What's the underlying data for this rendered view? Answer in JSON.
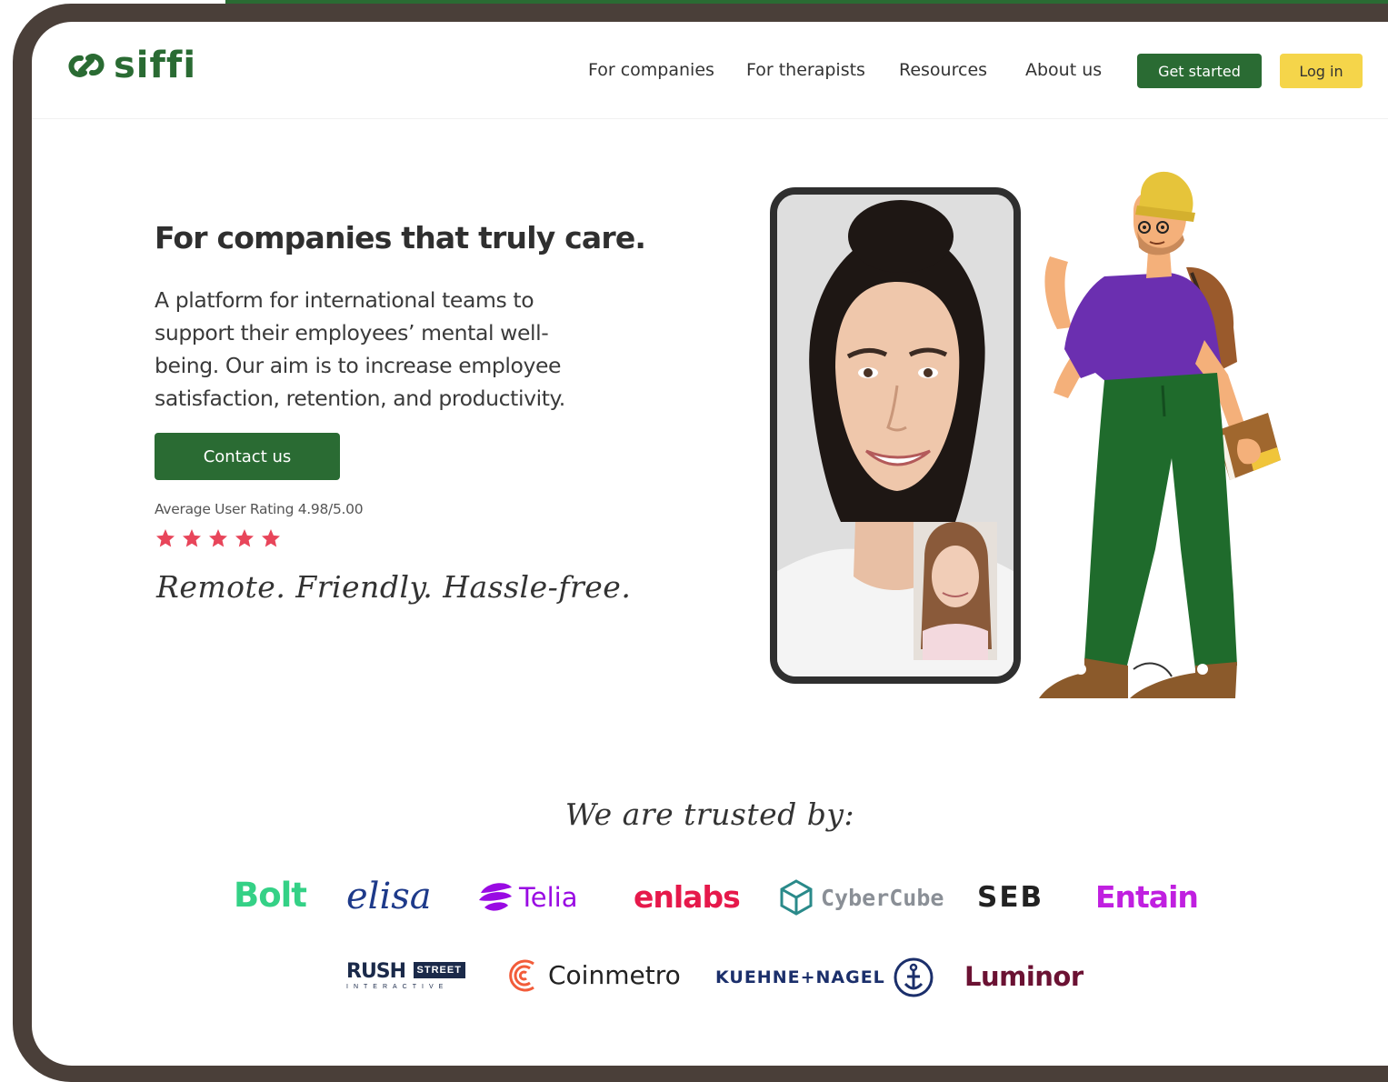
{
  "brand": {
    "name": "siffi",
    "color": "#2a6b33"
  },
  "nav": {
    "items": [
      "For companies",
      "For therapists",
      "Resources",
      "About us"
    ],
    "get_started": "Get started",
    "log_in": "Log in"
  },
  "hero": {
    "title": "For companies that truly care.",
    "description": "A platform for international teams to support their employees’ mental well-being. Our aim is to increase employee satisfaction, retention, and productivity.",
    "contact_button": "Contact us",
    "rating_text": "Average User Rating 4.98/5.00",
    "stars": 5,
    "tagline": "Remote. Friendly. Hassle-free."
  },
  "trusted": {
    "title": "We are trusted by:",
    "logos": [
      {
        "name": "Bolt",
        "color": "#34d186",
        "icon": "bolt-logo"
      },
      {
        "name": "elisa",
        "color": "#1e3a8a",
        "icon": "elisa-logo"
      },
      {
        "name": "Telia",
        "color": "#990ae3",
        "icon": "telia-logo"
      },
      {
        "name": "enlabs",
        "color": "#e6194b",
        "icon": "enlabs-logo"
      },
      {
        "name": "CyberCube",
        "color": "#8a8f96",
        "icon": "cybercube-logo"
      },
      {
        "name": "SEB",
        "color": "#222222",
        "icon": "seb-logo"
      },
      {
        "name": "Entain",
        "color": "#c020e0",
        "icon": "entain-logo"
      },
      {
        "name": "RUSH",
        "color": "#1b2a4a",
        "icon": "rush-street-logo"
      },
      {
        "name": "Coinmetro",
        "color": "#222222",
        "icon": "coinmetro-logo"
      },
      {
        "name": "KUEHNE+NAGEL",
        "color": "#1b2f6b",
        "icon": "kuehne-nagel-logo"
      },
      {
        "name": "Luminor",
        "color": "#6b1233",
        "icon": "luminor-logo"
      }
    ],
    "rush_sub1": "STREET",
    "rush_sub2": "INTERACTIVE"
  },
  "colors": {
    "primary": "#2a6b33",
    "accent": "#f5d54a",
    "star": "#e8455a",
    "frame": "#4a3f39"
  }
}
